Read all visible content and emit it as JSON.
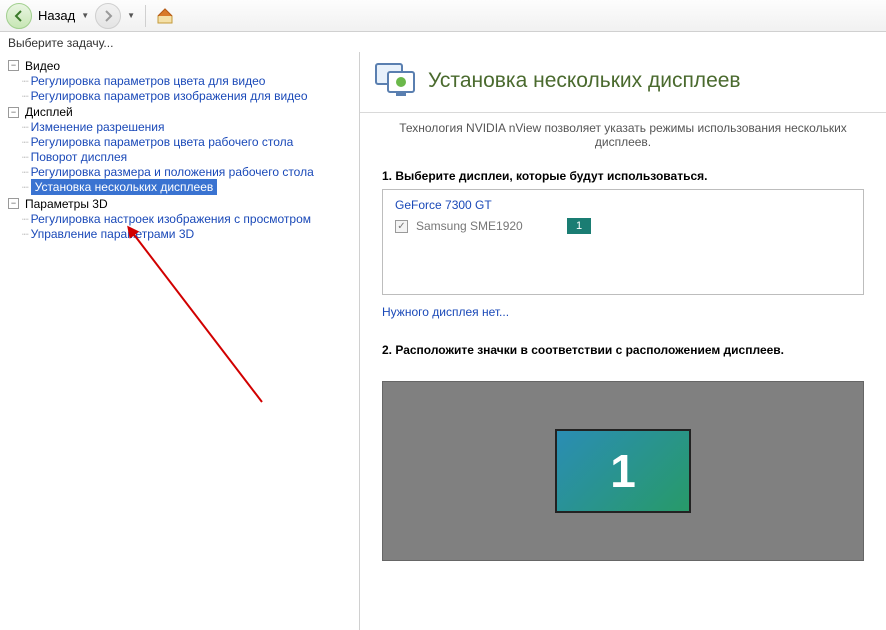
{
  "toolbar": {
    "back_label": "Назад"
  },
  "task_prompt": "Выберите задачу...",
  "tree": {
    "cat_video": "Видео",
    "video_color": "Регулировка параметров цвета для видео",
    "video_image": "Регулировка параметров изображения для видео",
    "cat_display": "Дисплей",
    "disp_resolution": "Изменение разрешения",
    "disp_desktop_color": "Регулировка параметров цвета рабочего стола",
    "disp_rotate": "Поворот дисплея",
    "disp_size_pos": "Регулировка размера и положения рабочего стола",
    "disp_multi": "Установка нескольких дисплеев",
    "cat_3d": "Параметры 3D",
    "p3d_preview": "Регулировка настроек изображения с просмотром",
    "p3d_manage": "Управление параметрами 3D"
  },
  "banner": {
    "title": "Установка нескольких дисплеев"
  },
  "subtext": "Технология NVIDIA nView позволяет указать режимы использования нескольких дисплеев.",
  "step1": {
    "title": "1. Выберите дисплеи, которые будут использоваться.",
    "gpu": "GeForce 7300 GT",
    "monitor": "Samsung SME1920",
    "badge": "1",
    "missing_link": "Нужного дисплея нет..."
  },
  "step2": {
    "title": "2. Расположите значки в соответствии с расположением дисплеев.",
    "tile": "1"
  }
}
